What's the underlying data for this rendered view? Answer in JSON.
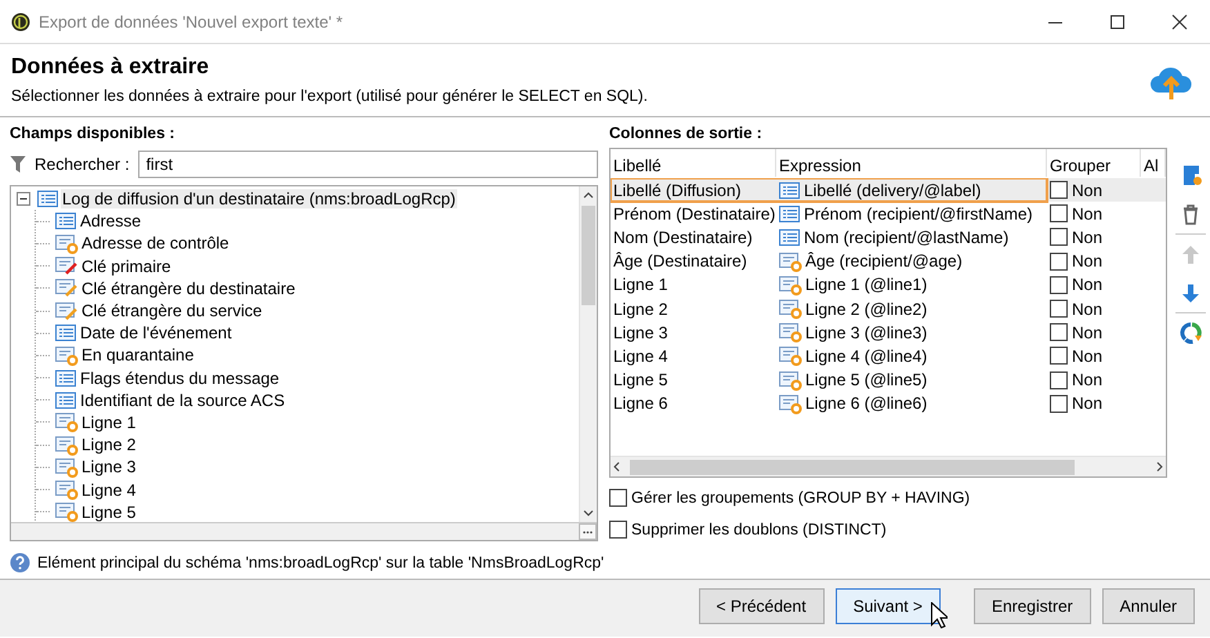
{
  "window": {
    "title": "Export de données 'Nouvel export texte' *"
  },
  "header": {
    "title": "Données à extraire",
    "subtitle": "Sélectionner les données à extraire pour l'export (utilisé pour générer le SELECT en SQL)."
  },
  "available_fields": {
    "label": "Champs disponibles :",
    "search": {
      "label": "Rechercher :",
      "value": "first"
    },
    "tree": [
      {
        "label": "Log de diffusion d'un destinataire (nms:broadLogRcp)",
        "kind": "field",
        "expanded": true,
        "selected": true,
        "children": [
          {
            "label": "Adresse",
            "kind": "field",
            "selected": false
          },
          {
            "label": "Adresse de contrôle",
            "kind": "computed",
            "selected": false
          },
          {
            "label": "Clé primaire",
            "kind": "primary-key",
            "selected": false
          },
          {
            "label": "Clé étrangère du destinataire",
            "kind": "foreign-key",
            "selected": false
          },
          {
            "label": "Clé étrangère du service",
            "kind": "foreign-key",
            "selected": false
          },
          {
            "label": "Date de l'événement",
            "kind": "field",
            "selected": false
          },
          {
            "label": "En quarantaine",
            "kind": "computed",
            "selected": false
          },
          {
            "label": "Flags étendus du message",
            "kind": "field",
            "selected": false
          },
          {
            "label": "Identifiant de la source ACS",
            "kind": "field",
            "selected": false
          },
          {
            "label": "Ligne 1",
            "kind": "computed",
            "selected": false
          },
          {
            "label": "Ligne 2",
            "kind": "computed",
            "selected": false
          },
          {
            "label": "Ligne 3",
            "kind": "computed",
            "selected": false
          },
          {
            "label": "Ligne 4",
            "kind": "computed",
            "selected": false
          },
          {
            "label": "Ligne 5",
            "kind": "computed",
            "selected": false
          }
        ]
      }
    ]
  },
  "info": "Elément principal du schéma 'nms:broadLogRcp' sur la table 'NmsBroadLogRcp'",
  "output_columns": {
    "label": "Colonnes de sortie :",
    "columns": [
      "Libellé",
      "Expression",
      "Grouper",
      "Al"
    ],
    "rows": [
      {
        "label": "Libellé (Diffusion)",
        "expression": "Libellé (delivery/@label)",
        "kind": "field",
        "group": false,
        "group_label": "Non",
        "selected": true
      },
      {
        "label": "Prénom (Destinataire)",
        "expression": "Prénom (recipient/@firstName)",
        "kind": "field",
        "group": false,
        "group_label": "Non",
        "selected": false
      },
      {
        "label": "Nom (Destinataire)",
        "expression": "Nom (recipient/@lastName)",
        "kind": "field",
        "group": false,
        "group_label": "Non",
        "selected": false
      },
      {
        "label": "Âge (Destinataire)",
        "expression": "Âge (recipient/@age)",
        "kind": "computed",
        "group": false,
        "group_label": "Non",
        "selected": false
      },
      {
        "label": "Ligne 1",
        "expression": "Ligne 1 (@line1)",
        "kind": "computed",
        "group": false,
        "group_label": "Non",
        "selected": false
      },
      {
        "label": "Ligne 2",
        "expression": "Ligne 2 (@line2)",
        "kind": "computed",
        "group": false,
        "group_label": "Non",
        "selected": false
      },
      {
        "label": "Ligne 3",
        "expression": "Ligne 3 (@line3)",
        "kind": "computed",
        "group": false,
        "group_label": "Non",
        "selected": false
      },
      {
        "label": "Ligne 4",
        "expression": "Ligne 4 (@line4)",
        "kind": "computed",
        "group": false,
        "group_label": "Non",
        "selected": false
      },
      {
        "label": "Ligne 5",
        "expression": "Ligne 5 (@line5)",
        "kind": "computed",
        "group": false,
        "group_label": "Non",
        "selected": false
      },
      {
        "label": "Ligne 6",
        "expression": "Ligne 6 (@line6)",
        "kind": "computed",
        "group": false,
        "group_label": "Non",
        "selected": false
      }
    ]
  },
  "options": [
    {
      "label": "Gérer les groupements (GROUP BY + HAVING)",
      "checked": false
    },
    {
      "label": "Supprimer les doublons (DISTINCT)",
      "checked": false
    }
  ],
  "toolbar": [
    {
      "kind": "add",
      "disabled": false
    },
    {
      "kind": "delete",
      "disabled": false
    },
    {
      "kind": "up",
      "disabled": true
    },
    {
      "kind": "down",
      "disabled": false
    },
    {
      "kind": "distribution",
      "disabled": false
    }
  ],
  "buttons": [
    {
      "label": "< Précédent",
      "default": false
    },
    {
      "label": "Suivant >",
      "default": true
    },
    {
      "label": "Enregistrer",
      "default": false
    },
    {
      "label": "Annuler",
      "default": false
    }
  ]
}
